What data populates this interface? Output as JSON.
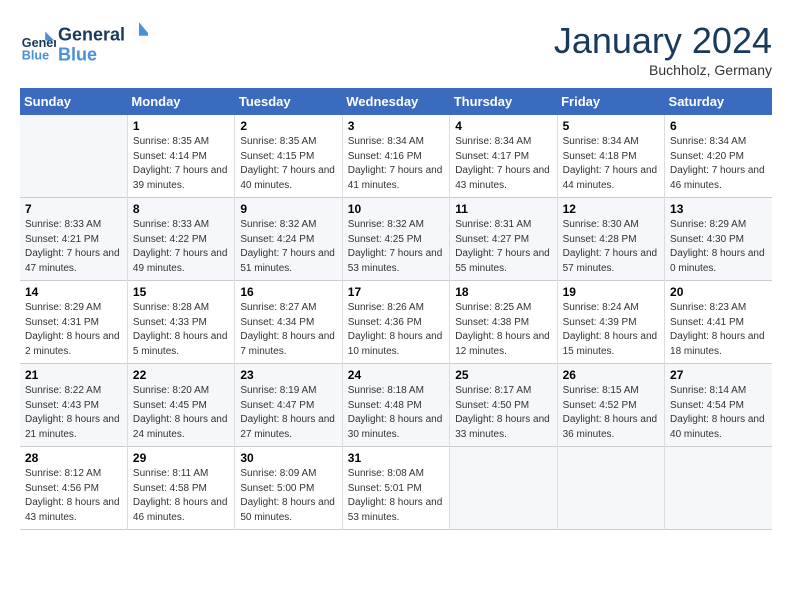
{
  "header": {
    "logo_line1": "General",
    "logo_line2": "Blue",
    "month_title": "January 2024",
    "subtitle": "Buchholz, Germany"
  },
  "weekdays": [
    "Sunday",
    "Monday",
    "Tuesday",
    "Wednesday",
    "Thursday",
    "Friday",
    "Saturday"
  ],
  "weeks": [
    [
      {
        "day": "",
        "sunrise": "",
        "sunset": "",
        "daylight": ""
      },
      {
        "day": "1",
        "sunrise": "Sunrise: 8:35 AM",
        "sunset": "Sunset: 4:14 PM",
        "daylight": "Daylight: 7 hours and 39 minutes."
      },
      {
        "day": "2",
        "sunrise": "Sunrise: 8:35 AM",
        "sunset": "Sunset: 4:15 PM",
        "daylight": "Daylight: 7 hours and 40 minutes."
      },
      {
        "day": "3",
        "sunrise": "Sunrise: 8:34 AM",
        "sunset": "Sunset: 4:16 PM",
        "daylight": "Daylight: 7 hours and 41 minutes."
      },
      {
        "day": "4",
        "sunrise": "Sunrise: 8:34 AM",
        "sunset": "Sunset: 4:17 PM",
        "daylight": "Daylight: 7 hours and 43 minutes."
      },
      {
        "day": "5",
        "sunrise": "Sunrise: 8:34 AM",
        "sunset": "Sunset: 4:18 PM",
        "daylight": "Daylight: 7 hours and 44 minutes."
      },
      {
        "day": "6",
        "sunrise": "Sunrise: 8:34 AM",
        "sunset": "Sunset: 4:20 PM",
        "daylight": "Daylight: 7 hours and 46 minutes."
      }
    ],
    [
      {
        "day": "7",
        "sunrise": "Sunrise: 8:33 AM",
        "sunset": "Sunset: 4:21 PM",
        "daylight": "Daylight: 7 hours and 47 minutes."
      },
      {
        "day": "8",
        "sunrise": "Sunrise: 8:33 AM",
        "sunset": "Sunset: 4:22 PM",
        "daylight": "Daylight: 7 hours and 49 minutes."
      },
      {
        "day": "9",
        "sunrise": "Sunrise: 8:32 AM",
        "sunset": "Sunset: 4:24 PM",
        "daylight": "Daylight: 7 hours and 51 minutes."
      },
      {
        "day": "10",
        "sunrise": "Sunrise: 8:32 AM",
        "sunset": "Sunset: 4:25 PM",
        "daylight": "Daylight: 7 hours and 53 minutes."
      },
      {
        "day": "11",
        "sunrise": "Sunrise: 8:31 AM",
        "sunset": "Sunset: 4:27 PM",
        "daylight": "Daylight: 7 hours and 55 minutes."
      },
      {
        "day": "12",
        "sunrise": "Sunrise: 8:30 AM",
        "sunset": "Sunset: 4:28 PM",
        "daylight": "Daylight: 7 hours and 57 minutes."
      },
      {
        "day": "13",
        "sunrise": "Sunrise: 8:29 AM",
        "sunset": "Sunset: 4:30 PM",
        "daylight": "Daylight: 8 hours and 0 minutes."
      }
    ],
    [
      {
        "day": "14",
        "sunrise": "Sunrise: 8:29 AM",
        "sunset": "Sunset: 4:31 PM",
        "daylight": "Daylight: 8 hours and 2 minutes."
      },
      {
        "day": "15",
        "sunrise": "Sunrise: 8:28 AM",
        "sunset": "Sunset: 4:33 PM",
        "daylight": "Daylight: 8 hours and 5 minutes."
      },
      {
        "day": "16",
        "sunrise": "Sunrise: 8:27 AM",
        "sunset": "Sunset: 4:34 PM",
        "daylight": "Daylight: 8 hours and 7 minutes."
      },
      {
        "day": "17",
        "sunrise": "Sunrise: 8:26 AM",
        "sunset": "Sunset: 4:36 PM",
        "daylight": "Daylight: 8 hours and 10 minutes."
      },
      {
        "day": "18",
        "sunrise": "Sunrise: 8:25 AM",
        "sunset": "Sunset: 4:38 PM",
        "daylight": "Daylight: 8 hours and 12 minutes."
      },
      {
        "day": "19",
        "sunrise": "Sunrise: 8:24 AM",
        "sunset": "Sunset: 4:39 PM",
        "daylight": "Daylight: 8 hours and 15 minutes."
      },
      {
        "day": "20",
        "sunrise": "Sunrise: 8:23 AM",
        "sunset": "Sunset: 4:41 PM",
        "daylight": "Daylight: 8 hours and 18 minutes."
      }
    ],
    [
      {
        "day": "21",
        "sunrise": "Sunrise: 8:22 AM",
        "sunset": "Sunset: 4:43 PM",
        "daylight": "Daylight: 8 hours and 21 minutes."
      },
      {
        "day": "22",
        "sunrise": "Sunrise: 8:20 AM",
        "sunset": "Sunset: 4:45 PM",
        "daylight": "Daylight: 8 hours and 24 minutes."
      },
      {
        "day": "23",
        "sunrise": "Sunrise: 8:19 AM",
        "sunset": "Sunset: 4:47 PM",
        "daylight": "Daylight: 8 hours and 27 minutes."
      },
      {
        "day": "24",
        "sunrise": "Sunrise: 8:18 AM",
        "sunset": "Sunset: 4:48 PM",
        "daylight": "Daylight: 8 hours and 30 minutes."
      },
      {
        "day": "25",
        "sunrise": "Sunrise: 8:17 AM",
        "sunset": "Sunset: 4:50 PM",
        "daylight": "Daylight: 8 hours and 33 minutes."
      },
      {
        "day": "26",
        "sunrise": "Sunrise: 8:15 AM",
        "sunset": "Sunset: 4:52 PM",
        "daylight": "Daylight: 8 hours and 36 minutes."
      },
      {
        "day": "27",
        "sunrise": "Sunrise: 8:14 AM",
        "sunset": "Sunset: 4:54 PM",
        "daylight": "Daylight: 8 hours and 40 minutes."
      }
    ],
    [
      {
        "day": "28",
        "sunrise": "Sunrise: 8:12 AM",
        "sunset": "Sunset: 4:56 PM",
        "daylight": "Daylight: 8 hours and 43 minutes."
      },
      {
        "day": "29",
        "sunrise": "Sunrise: 8:11 AM",
        "sunset": "Sunset: 4:58 PM",
        "daylight": "Daylight: 8 hours and 46 minutes."
      },
      {
        "day": "30",
        "sunrise": "Sunrise: 8:09 AM",
        "sunset": "Sunset: 5:00 PM",
        "daylight": "Daylight: 8 hours and 50 minutes."
      },
      {
        "day": "31",
        "sunrise": "Sunrise: 8:08 AM",
        "sunset": "Sunset: 5:01 PM",
        "daylight": "Daylight: 8 hours and 53 minutes."
      },
      {
        "day": "",
        "sunrise": "",
        "sunset": "",
        "daylight": ""
      },
      {
        "day": "",
        "sunrise": "",
        "sunset": "",
        "daylight": ""
      },
      {
        "day": "",
        "sunrise": "",
        "sunset": "",
        "daylight": ""
      }
    ]
  ]
}
